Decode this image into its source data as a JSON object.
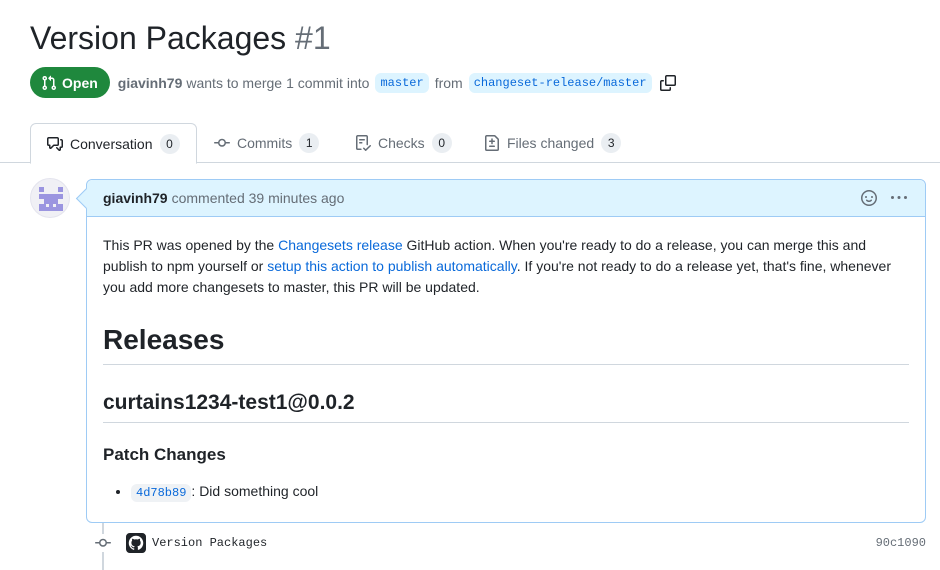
{
  "pr": {
    "title": "Version Packages",
    "number": "#1",
    "state": "Open",
    "author": "giavinh79",
    "merge_text": "wants to merge",
    "commit_count": "1 commit",
    "into_text": "into",
    "base_branch": "master",
    "from_text": "from",
    "head_branch": "changeset-release/master"
  },
  "tabs": [
    {
      "label": "Conversation",
      "count": "0",
      "icon": "comment-discussion-icon"
    },
    {
      "label": "Commits",
      "count": "1",
      "icon": "git-commit-icon"
    },
    {
      "label": "Checks",
      "count": "0",
      "icon": "checklist-icon"
    },
    {
      "label": "Files changed",
      "count": "3",
      "icon": "file-diff-icon"
    }
  ],
  "comment": {
    "author": "giavinh79",
    "action": "commented",
    "time": "39 minutes ago",
    "body": {
      "p_1": "This PR was opened by the ",
      "link_1": "Changesets release",
      "p_2": " GitHub action. When you're ready to do a release, you can merge this and publish to npm yourself or ",
      "link_2": "setup this action to publish automatically",
      "p_3": ". If you're not ready to do a release yet, that's fine, whenever you add more changesets to master, this PR will be updated.",
      "heading_1": "Releases",
      "heading_2": "curtains1234-test1@0.0.2",
      "heading_3": "Patch Changes",
      "changes": [
        {
          "sha": "4d78b89",
          "text": ": Did something cool"
        }
      ]
    }
  },
  "commit": {
    "message": "Version Packages",
    "sha": "90c1090"
  },
  "colors": {
    "open_green": "#1f883d",
    "link_blue": "#0969da",
    "header_blue": "#ddf4ff",
    "border_blue": "#9ecbf5"
  }
}
